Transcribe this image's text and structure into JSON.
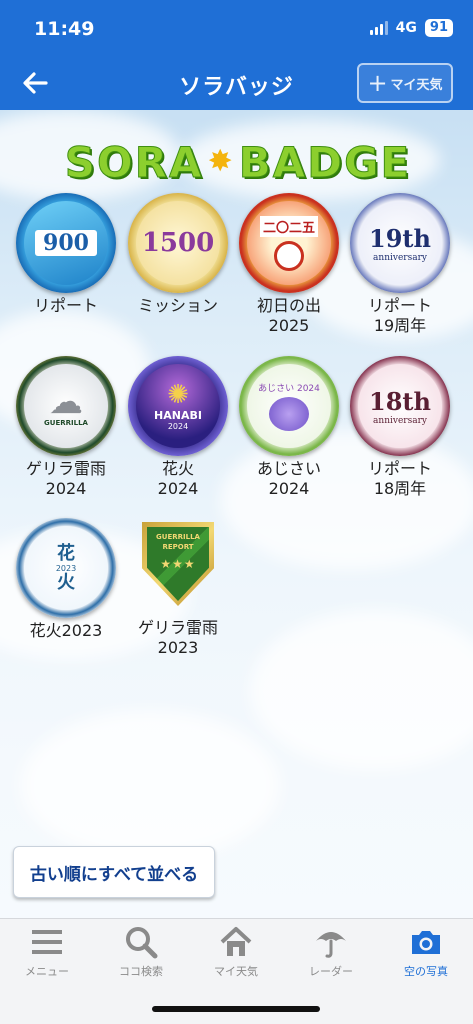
{
  "status": {
    "time": "11:49",
    "network": "4G",
    "battery": "91"
  },
  "nav": {
    "title": "ソラバッジ",
    "my_weather_label": "マイ天気",
    "plus": "+"
  },
  "logo": {
    "left": "SORA",
    "right": "BADGE"
  },
  "badges": [
    {
      "label": "リポート",
      "medal_text": "900"
    },
    {
      "label": "ミッション",
      "medal_text": "1500"
    },
    {
      "label": "初日の出\n2025",
      "medal_text": "二〇二五"
    },
    {
      "label": "リポート\n19周年",
      "medal_text": "19th",
      "medal_sub": "anniversary"
    },
    {
      "label": "ゲリラ雷雨\n2024",
      "medal_text": "GUERRILLA"
    },
    {
      "label": "花火\n2024",
      "medal_text": "HANABI",
      "medal_sub": "2024"
    },
    {
      "label": "あじさい\n2024",
      "medal_text": "あじさい 2024"
    },
    {
      "label": "リポート\n18周年",
      "medal_text": "18th",
      "medal_sub": "anniversary"
    },
    {
      "label": "花火2023",
      "medal_text": "花",
      "medal_text2": "火",
      "medal_sub": "2023"
    },
    {
      "label": "ゲリラ雷雨\n2023",
      "medal_text": "GUERRILLA",
      "medal_sub": "REPORT"
    }
  ],
  "sort_button": "古い順にすべて並べる",
  "tabs": [
    {
      "label": "メニュー",
      "icon": "menu-icon"
    },
    {
      "label": "ココ検索",
      "icon": "search-icon"
    },
    {
      "label": "マイ天気",
      "icon": "home-icon"
    },
    {
      "label": "レーダー",
      "icon": "umbrella-icon"
    },
    {
      "label": "空の写真",
      "icon": "camera-icon",
      "active": true
    }
  ],
  "colors": {
    "brand_blue": "#1f6fd6",
    "logo_green": "#8ccf2e",
    "tab_active": "#1f6fd6",
    "tab_inactive": "#8a8a8a"
  }
}
